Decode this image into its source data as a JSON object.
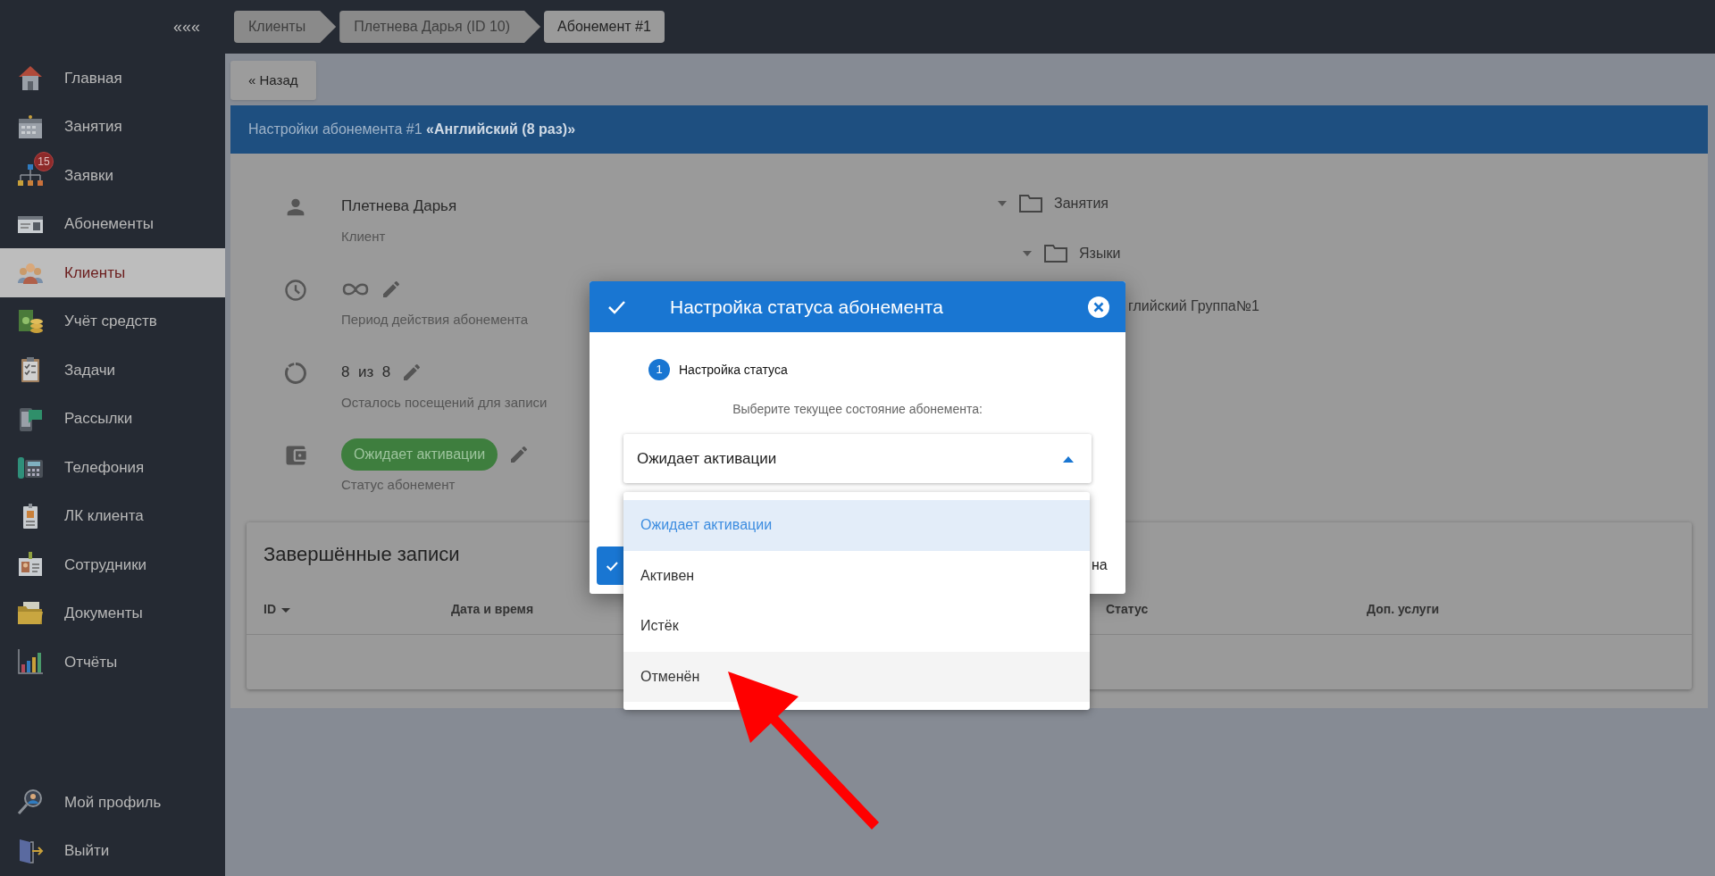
{
  "sidebar": {
    "collapse": "«««",
    "items": [
      {
        "label": "Главная",
        "selected": false
      },
      {
        "label": "Занятия",
        "selected": false
      },
      {
        "label": "Заявки",
        "selected": false,
        "badge": "15"
      },
      {
        "label": "Абонементы",
        "selected": false
      },
      {
        "label": "Клиенты",
        "selected": true
      },
      {
        "label": "Учёт средств",
        "selected": false
      },
      {
        "label": "Задачи",
        "selected": false
      },
      {
        "label": "Рассылки",
        "selected": false
      },
      {
        "label": "Телефония",
        "selected": false
      },
      {
        "label": "ЛК клиента",
        "selected": false
      },
      {
        "label": "Сотрудники",
        "selected": false
      },
      {
        "label": "Документы",
        "selected": false
      },
      {
        "label": "Отчёты",
        "selected": false
      }
    ],
    "footer_items": [
      {
        "label": "Мой профиль"
      },
      {
        "label": "Выйти"
      }
    ]
  },
  "breadcrumbs": [
    {
      "label": "Клиенты",
      "current": false
    },
    {
      "label": "Плетнева Дарья (ID 10)",
      "current": false
    },
    {
      "label": "Абонемент #1",
      "current": true
    }
  ],
  "back_button": "« Назад",
  "panel": {
    "title": "Настройки абонемента #1 **«Английский (8 раз)»**",
    "info": [
      {
        "kind": "person",
        "value": "Плетнева Дарья",
        "label": "Клиент",
        "editable": false
      },
      {
        "kind": "period",
        "label": "Период действия абонемента",
        "editable": true
      },
      {
        "kind": "visits",
        "value": "8  из  8",
        "label": "Осталось посещений для записи",
        "editable": true
      },
      {
        "kind": "status",
        "value": "Ожидает активации",
        "label": "Статус абонемент",
        "editable": true
      }
    ],
    "tree": [
      {
        "label": "Занятия",
        "expanded": true,
        "children": [
          {
            "label": "Языки",
            "expanded": true,
            "children": [
              {
                "label": "глийский Группа№1"
              }
            ]
          }
        ]
      }
    ]
  },
  "records": {
    "title": "Завершённые записи",
    "columns": [
      {
        "label": "ID",
        "sorted": true
      },
      {
        "label": "Дата и время",
        "sorted": false
      },
      {
        "label": "Статус",
        "sorted": false
      },
      {
        "label": "Доп. услуги",
        "sorted": false
      }
    ]
  },
  "dialog": {
    "title": "Настройка статуса абонемента",
    "step": {
      "number": "1",
      "label": "Настройка статуса"
    },
    "prompt": "Выберите текущее состояние абонемента:",
    "select": {
      "value": "Ожидает активации",
      "expanded": true,
      "options": [
        {
          "label": "Ожидает активации",
          "selected": true,
          "hovered": false
        },
        {
          "label": "Активен",
          "selected": false,
          "hovered": false
        },
        {
          "label": "Истёк",
          "selected": false,
          "hovered": false
        },
        {
          "label": "Отменён",
          "selected": false,
          "hovered": true
        }
      ]
    },
    "cancel_fragment": "на"
  }
}
